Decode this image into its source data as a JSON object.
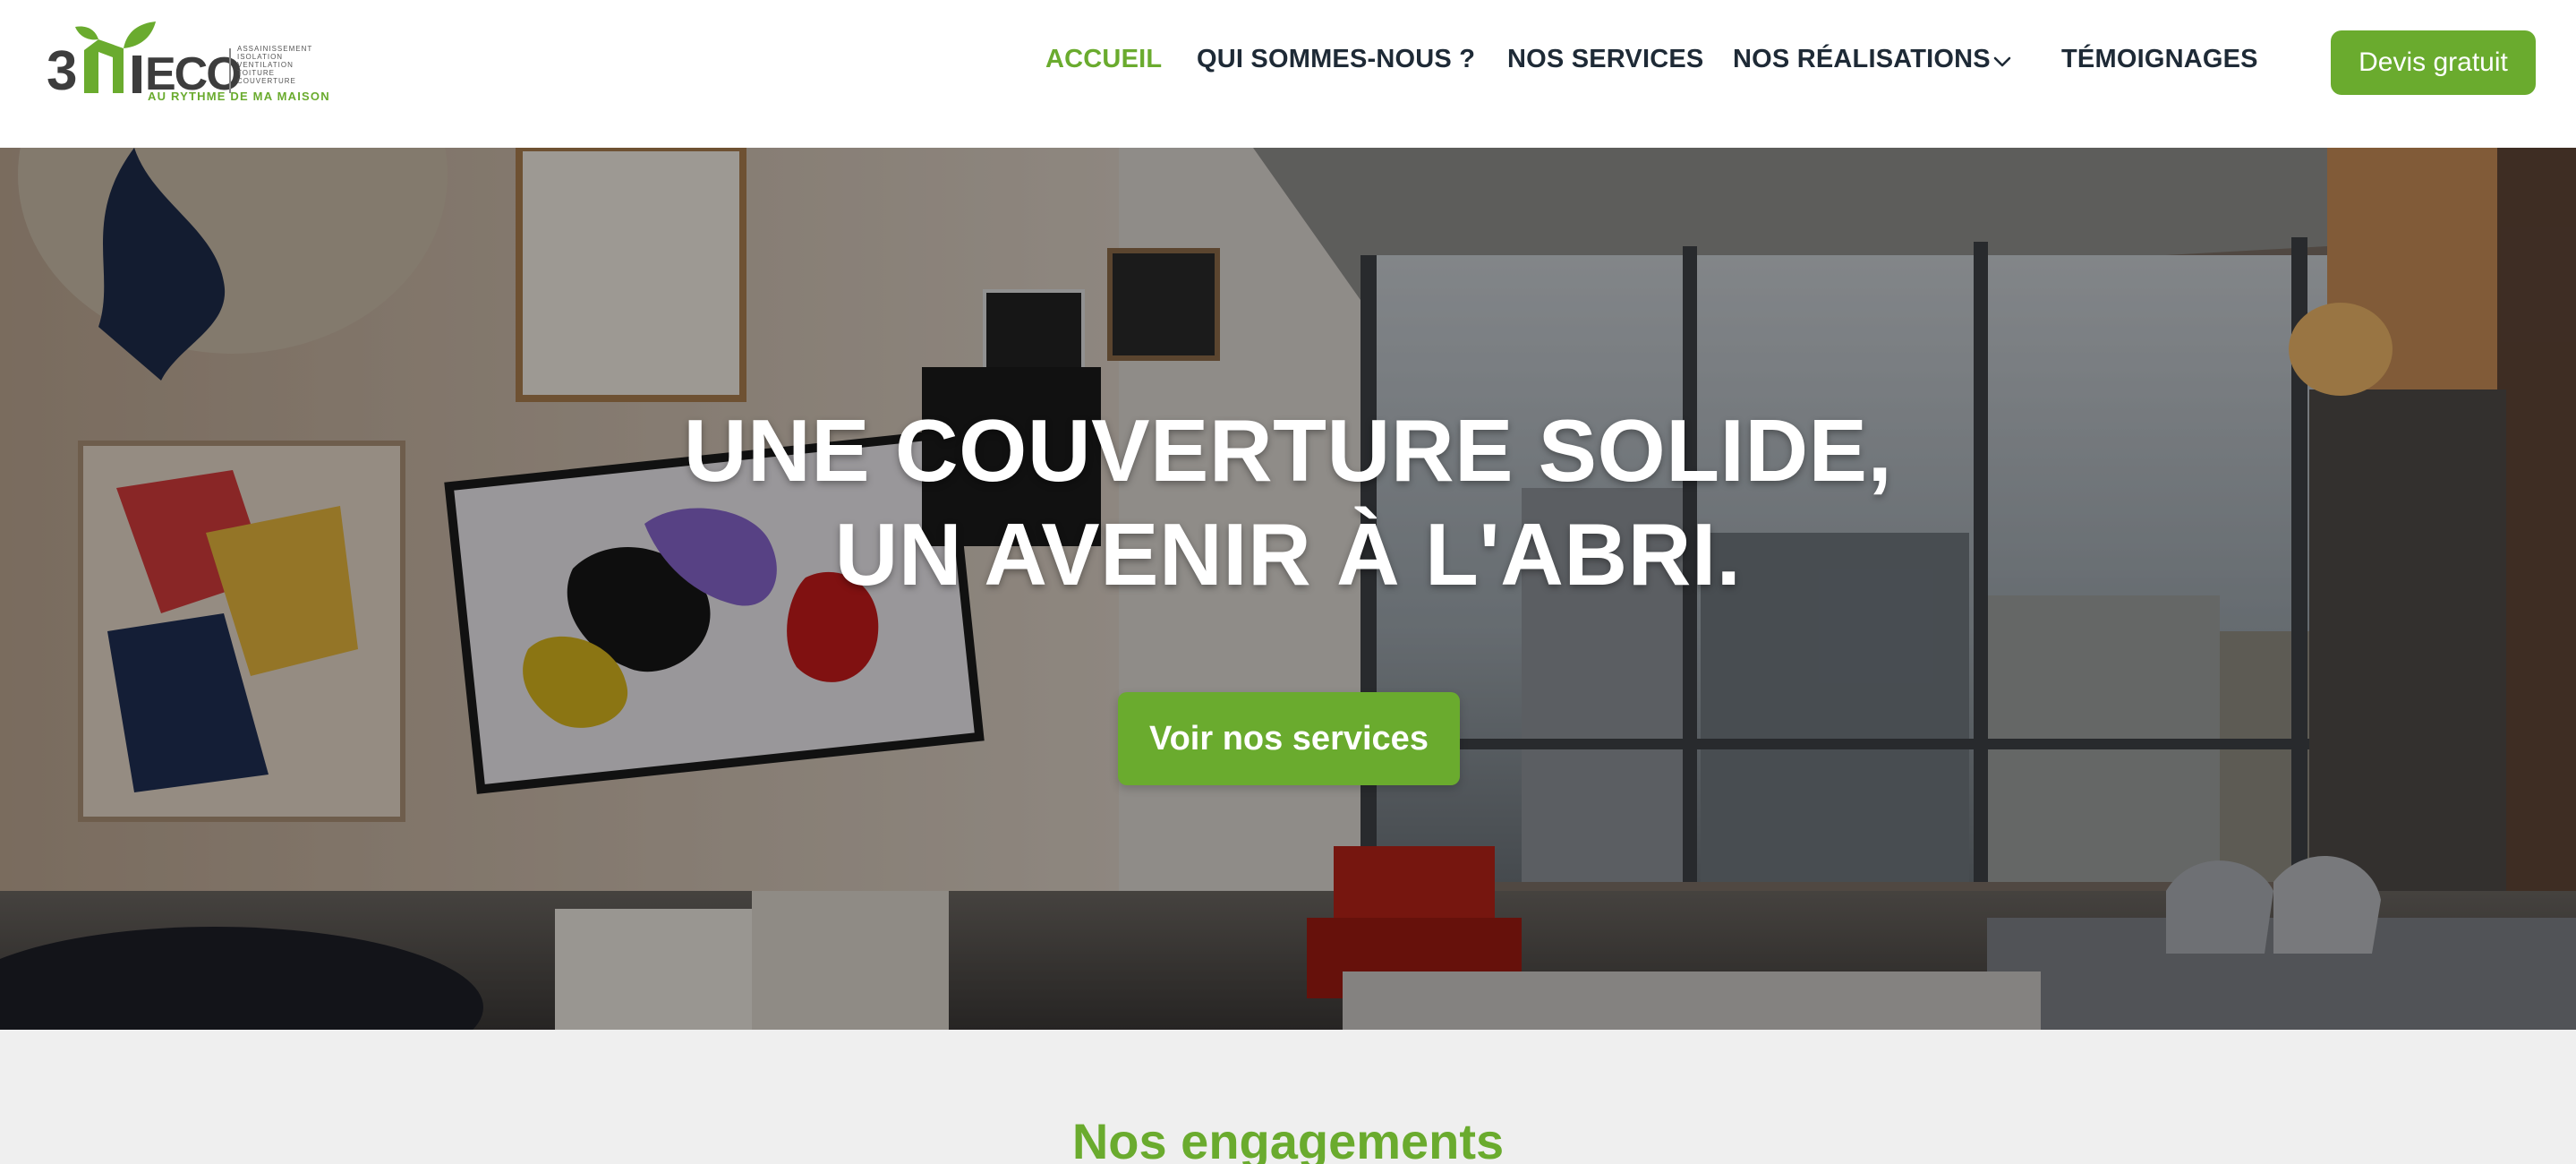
{
  "brand": {
    "logo_text": "3",
    "logo_word": "ECO",
    "tagline": "AU RYTHME DE MA MAISON",
    "services_lines": [
      "ASSAINISSEMENT",
      "ISOLATION",
      "VENTILATION",
      "TOITURE",
      "COUVERTURE"
    ],
    "accent_color": "#6aab2e"
  },
  "nav": {
    "items": [
      {
        "label": "ACCUEIL",
        "active": true
      },
      {
        "label": "QUI SOMMES-NOUS ?",
        "active": false
      },
      {
        "label": "NOS SERVICES",
        "active": false
      },
      {
        "label": "NOS RÉALISATIONS",
        "active": false,
        "dropdown_icon": "chevron-down-icon"
      },
      {
        "label": "TÉMOIGNAGES",
        "active": false
      }
    ],
    "cta_label": "Devis gratuit"
  },
  "hero": {
    "title_line1": "UNE COUVERTURE SOLIDE,",
    "title_line2": "UN AVENIR À L'ABRI.",
    "button_label": "Voir nos services"
  },
  "section": {
    "title": "Nos engagements"
  }
}
